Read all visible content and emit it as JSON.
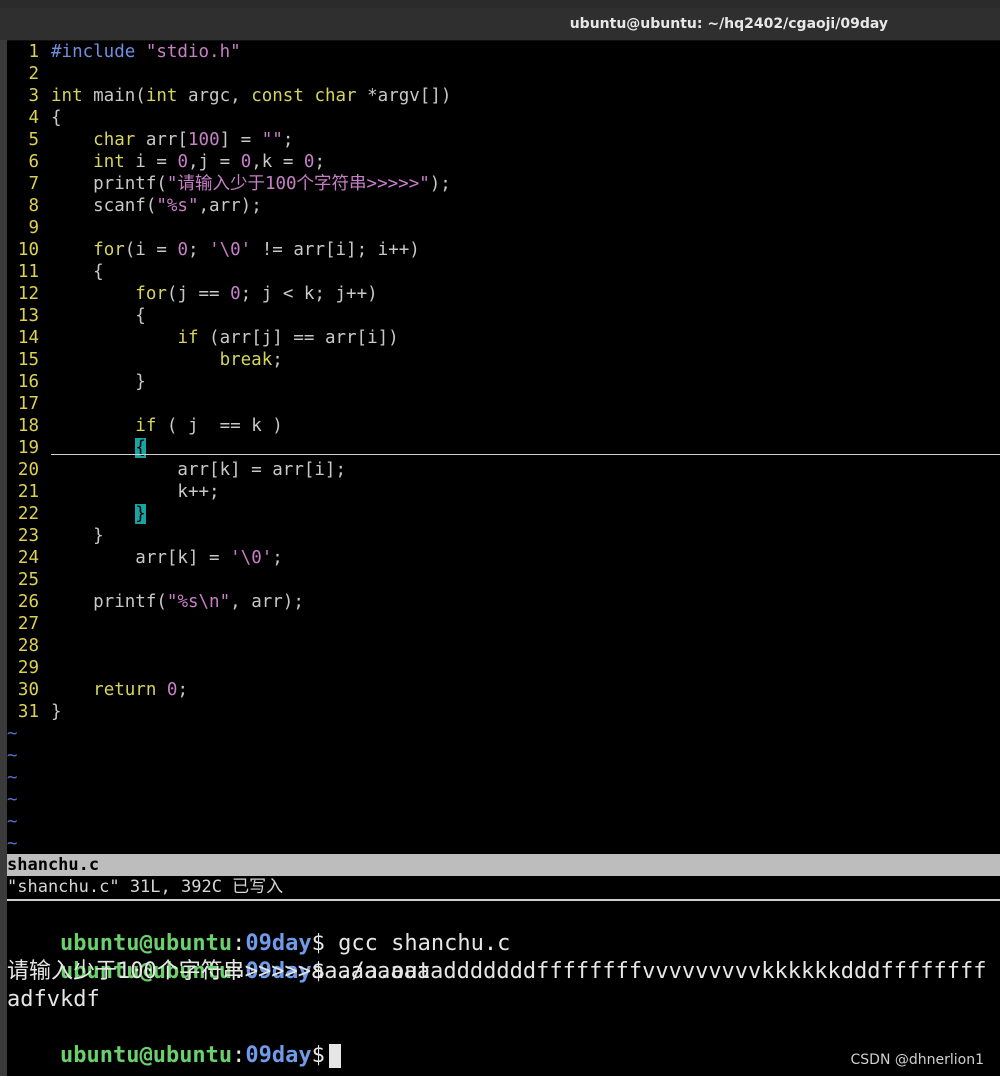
{
  "window": {
    "title": "ubuntu@ubuntu: ~/hq2402/cgaoji/09day"
  },
  "code_lines": [
    [
      {
        "t": "#include ",
        "c": "pp"
      },
      {
        "t": "\"stdio.h\"",
        "c": "str"
      }
    ],
    [],
    [
      {
        "t": "int",
        "c": "kw"
      },
      {
        "t": " main(",
        "c": "tx"
      },
      {
        "t": "int",
        "c": "kw"
      },
      {
        "t": " argc, ",
        "c": "tx"
      },
      {
        "t": "const",
        "c": "kw"
      },
      {
        "t": " ",
        "c": "tx"
      },
      {
        "t": "char",
        "c": "kw"
      },
      {
        "t": " *argv[])",
        "c": "tx"
      }
    ],
    [
      {
        "t": "{",
        "c": "tx"
      }
    ],
    [
      {
        "t": "    ",
        "c": "tx"
      },
      {
        "t": "char",
        "c": "kw"
      },
      {
        "t": " arr[",
        "c": "tx"
      },
      {
        "t": "100",
        "c": "num"
      },
      {
        "t": "] = ",
        "c": "tx"
      },
      {
        "t": "\"\"",
        "c": "str"
      },
      {
        "t": ";",
        "c": "tx"
      }
    ],
    [
      {
        "t": "    ",
        "c": "tx"
      },
      {
        "t": "int",
        "c": "kw"
      },
      {
        "t": " i = ",
        "c": "tx"
      },
      {
        "t": "0",
        "c": "num"
      },
      {
        "t": ",j = ",
        "c": "tx"
      },
      {
        "t": "0",
        "c": "num"
      },
      {
        "t": ",k = ",
        "c": "tx"
      },
      {
        "t": "0",
        "c": "num"
      },
      {
        "t": ";",
        "c": "tx"
      }
    ],
    [
      {
        "t": "    printf(",
        "c": "tx"
      },
      {
        "t": "\"请输入少于100个字符串>>>>>\"",
        "c": "str"
      },
      {
        "t": ");",
        "c": "tx"
      }
    ],
    [
      {
        "t": "    scanf(",
        "c": "tx"
      },
      {
        "t": "\"%s\"",
        "c": "str"
      },
      {
        "t": ",arr);",
        "c": "tx"
      }
    ],
    [],
    [
      {
        "t": "    ",
        "c": "tx"
      },
      {
        "t": "for",
        "c": "kw"
      },
      {
        "t": "(i = ",
        "c": "tx"
      },
      {
        "t": "0",
        "c": "num"
      },
      {
        "t": "; ",
        "c": "tx"
      },
      {
        "t": "'\\0'",
        "c": "str"
      },
      {
        "t": " != arr[i]; i++)",
        "c": "tx"
      }
    ],
    [
      {
        "t": "    {",
        "c": "tx"
      }
    ],
    [
      {
        "t": "        ",
        "c": "tx"
      },
      {
        "t": "for",
        "c": "kw"
      },
      {
        "t": "(j == ",
        "c": "tx"
      },
      {
        "t": "0",
        "c": "num"
      },
      {
        "t": "; j < k; j++)",
        "c": "tx"
      }
    ],
    [
      {
        "t": "        {",
        "c": "tx"
      }
    ],
    [
      {
        "t": "            ",
        "c": "tx"
      },
      {
        "t": "if",
        "c": "kw"
      },
      {
        "t": " (arr[j] == arr[i])",
        "c": "tx"
      }
    ],
    [
      {
        "t": "                ",
        "c": "tx"
      },
      {
        "t": "break",
        "c": "kw"
      },
      {
        "t": ";",
        "c": "tx"
      }
    ],
    [
      {
        "t": "        }",
        "c": "tx"
      }
    ],
    [],
    [
      {
        "t": "        ",
        "c": "tx"
      },
      {
        "t": "if",
        "c": "kw"
      },
      {
        "t": " ( j  == k )",
        "c": "tx"
      }
    ],
    [
      {
        "t": "        ",
        "c": "tx"
      },
      {
        "t": "{",
        "c": "match"
      }
    ],
    [
      {
        "t": "            arr[k] = arr[i];",
        "c": "tx"
      }
    ],
    [
      {
        "t": "            k++;",
        "c": "tx"
      }
    ],
    [
      {
        "t": "        ",
        "c": "tx"
      },
      {
        "t": "}",
        "c": "match"
      }
    ],
    [
      {
        "t": "    }",
        "c": "tx"
      }
    ],
    [
      {
        "t": "        arr[k] = ",
        "c": "tx"
      },
      {
        "t": "'\\0'",
        "c": "str"
      },
      {
        "t": ";",
        "c": "tx"
      }
    ],
    [],
    [
      {
        "t": "    printf(",
        "c": "tx"
      },
      {
        "t": "\"%s\\n\"",
        "c": "str"
      },
      {
        "t": ", arr);",
        "c": "tx"
      }
    ],
    [],
    [],
    [],
    [
      {
        "t": "    ",
        "c": "tx"
      },
      {
        "t": "return",
        "c": "kw"
      },
      {
        "t": " ",
        "c": "tx"
      },
      {
        "t": "0",
        "c": "num"
      },
      {
        "t": ";",
        "c": "tx"
      }
    ],
    [
      {
        "t": "}",
        "c": "tx"
      }
    ]
  ],
  "tilde_count": 6,
  "tilde_char": "~",
  "vim": {
    "filename": "shanchu.c",
    "message": "\"shanchu.c\" 31L, 392C 已写入"
  },
  "shell": {
    "user_host": "ubuntu@ubuntu",
    "colon": ":",
    "dir": "09day",
    "dollar": "$",
    "cmd1": " gcc shanchu.c",
    "cmd2": " ./a.out",
    "output1": "请输入少于100个字符串>>>>>aaaaaaaaaadddddddffffffffvvvvvvvvvkkkkkkdddffffffff",
    "output2": "adfvkdf"
  },
  "watermark": "CSDN @dhnerlion1"
}
